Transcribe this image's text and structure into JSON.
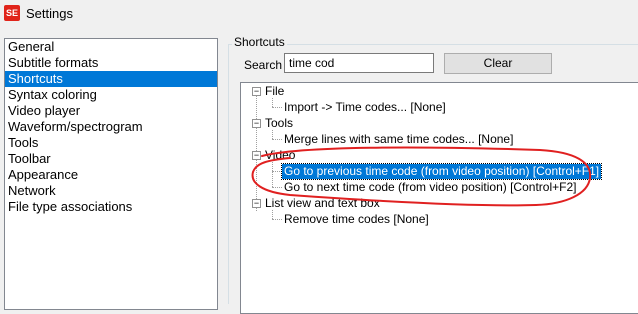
{
  "window": {
    "title": "Settings",
    "app_icon_text": "SE"
  },
  "nav": {
    "items": [
      "General",
      "Subtitle formats",
      "Shortcuts",
      "Syntax coloring",
      "Video player",
      "Waveform/spectrogram",
      "Tools",
      "Toolbar",
      "Appearance",
      "Network",
      "File type associations"
    ],
    "selected_index": 2
  },
  "shortcuts": {
    "group_label": "Shortcuts",
    "search_label": "Search",
    "search_value": "time cod",
    "clear_label": "Clear",
    "tree": {
      "file": {
        "label": "File",
        "children": [
          "Import -> Time codes... [None]"
        ]
      },
      "tools": {
        "label": "Tools",
        "children": [
          "Merge lines with same time codes... [None]"
        ]
      },
      "video": {
        "label": "Video",
        "children": [
          "Go to previous time code (from video position) [Control+F1]",
          "Go to next time code (from video position) [Control+F2]"
        ]
      },
      "listview": {
        "label": "List view and text box",
        "children": [
          "Remove time codes [None]"
        ]
      },
      "expander_symbol": "−"
    }
  },
  "colors": {
    "selection": "#0078d7",
    "annotation": "#e02020"
  }
}
